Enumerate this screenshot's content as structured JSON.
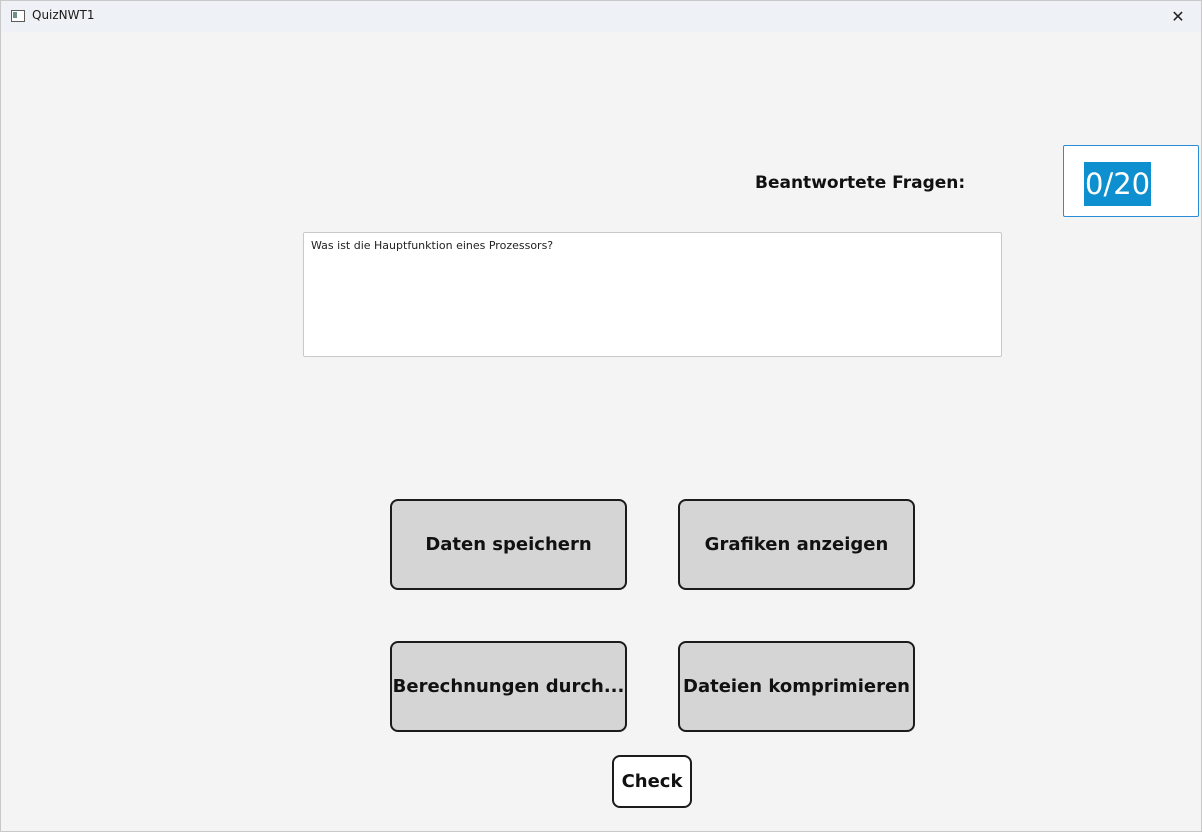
{
  "window": {
    "title": "QuizNWT1",
    "icon": "app-window-icon",
    "close_glyph": "✕"
  },
  "progress": {
    "label": "Beantwortete Fragen:",
    "value": "0/20",
    "answered": 0,
    "total": 20
  },
  "question": {
    "text": "Was ist die Hauptfunktion eines Prozessors?"
  },
  "answers": [
    {
      "label": "Daten speichern"
    },
    {
      "label": "Grafiken anzeigen"
    },
    {
      "label": "Berechnungen durch..."
    },
    {
      "label": "Dateien komprimieren"
    }
  ],
  "actions": {
    "check_label": "Check"
  },
  "colors": {
    "selection_highlight": "#0e8fcf",
    "focus_border": "#2a8cd6",
    "button_fill": "#d5d5d5"
  }
}
